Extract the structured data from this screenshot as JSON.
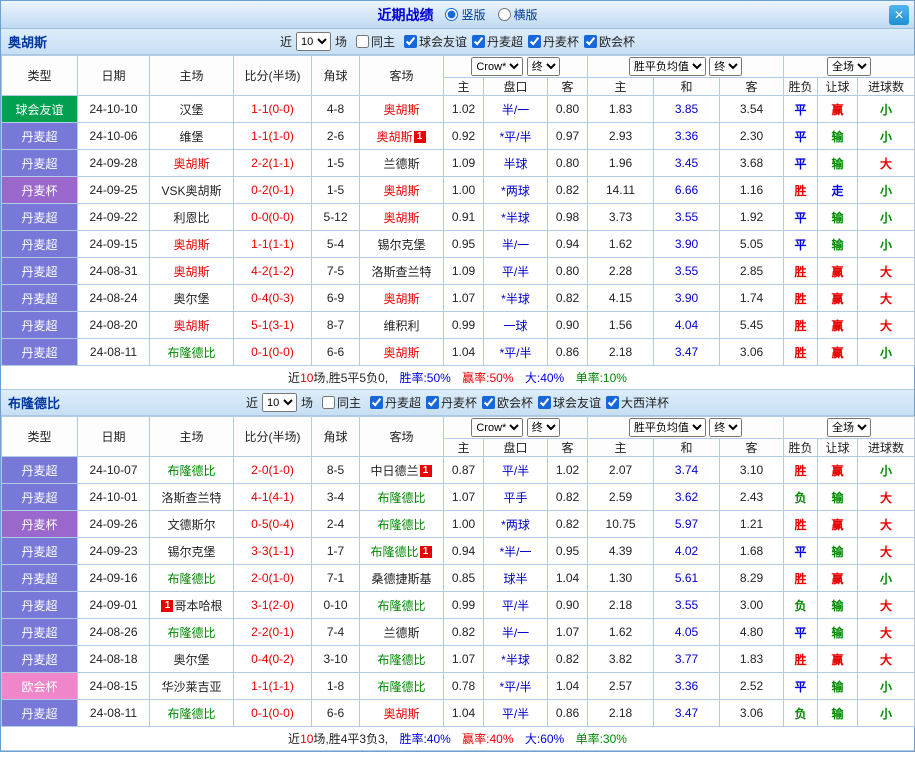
{
  "titlebar": {
    "title": "近期战绩",
    "vertical": "竖版",
    "horizontal": "横版",
    "close": "✕"
  },
  "palette": {
    "win_red": "#e80000",
    "lose_green": "#008800",
    "draw_blue": "#0000e6",
    "type_friendly": "#00a050",
    "type_super": "#7878d8",
    "type_cup": "#9a68cc",
    "type_conf": "#ef86ca"
  },
  "table_header": {
    "type": "类型",
    "date": "日期",
    "home": "主场",
    "score": "比分(半场)",
    "corner": "角球",
    "away": "客场",
    "odds_source": "Crow*",
    "final": "终",
    "avg_label": "胜平负均值",
    "scope": "全场",
    "h": "主",
    "handicap": "盘口",
    "a": "客",
    "draw": "和",
    "result": "胜负",
    "let": "让球",
    "goals": "进球数"
  },
  "sections": [
    {
      "team": "奥胡斯",
      "filter": {
        "near": "近",
        "count": "10",
        "games": "场",
        "same_home": "同主",
        "leagues": [
          "球会友谊",
          "丹麦超",
          "丹麦杯",
          "欧会杯"
        ]
      },
      "rows": [
        {
          "league": "球会友谊",
          "league_key": "friendly",
          "date": "24-10-10",
          "home": {
            "name": "汉堡"
          },
          "score": "1-1(0-0)",
          "corners": "4-8",
          "away": {
            "name": "奥胡斯",
            "color": "red"
          },
          "odds": [
            "1.02",
            "半/一",
            "0.80"
          ],
          "avg": [
            "1.83",
            "3.85",
            "3.54"
          ],
          "result": {
            "text": "平",
            "color": "blue"
          },
          "asian": {
            "text": "赢",
            "color": "red"
          },
          "goals": {
            "text": "小",
            "color": "green"
          }
        },
        {
          "league": "丹麦超",
          "league_key": "super",
          "date": "24-10-06",
          "home": {
            "name": "维堡"
          },
          "score": "1-1(1-0)",
          "corners": "2-6",
          "away": {
            "name": "奥胡斯",
            "color": "red",
            "badge": "after"
          },
          "odds": [
            "0.92",
            "*平/半",
            "0.97"
          ],
          "avg": [
            "2.93",
            "3.36",
            "2.30"
          ],
          "result": {
            "text": "平",
            "color": "blue"
          },
          "asian": {
            "text": "输",
            "color": "green"
          },
          "goals": {
            "text": "小",
            "color": "green"
          }
        },
        {
          "league": "丹麦超",
          "league_key": "super",
          "date": "24-09-28",
          "home": {
            "name": "奥胡斯",
            "color": "red"
          },
          "score": "2-2(1-1)",
          "corners": "1-5",
          "away": {
            "name": "兰德斯"
          },
          "odds": [
            "1.09",
            "半球",
            "0.80"
          ],
          "avg": [
            "1.96",
            "3.45",
            "3.68"
          ],
          "result": {
            "text": "平",
            "color": "blue"
          },
          "asian": {
            "text": "输",
            "color": "green"
          },
          "goals": {
            "text": "大",
            "color": "red"
          }
        },
        {
          "league": "丹麦杯",
          "league_key": "cup",
          "date": "24-09-25",
          "home": {
            "name": "VSK奥胡斯"
          },
          "score": "0-2(0-1)",
          "corners": "1-5",
          "away": {
            "name": "奥胡斯",
            "color": "red"
          },
          "odds": [
            "1.00",
            "*两球",
            "0.82"
          ],
          "avg": [
            "14.11",
            "6.66",
            "1.16"
          ],
          "result": {
            "text": "胜",
            "color": "red"
          },
          "asian": {
            "text": "走",
            "color": "blue"
          },
          "goals": {
            "text": "小",
            "color": "green"
          }
        },
        {
          "league": "丹麦超",
          "league_key": "super",
          "date": "24-09-22",
          "home": {
            "name": "利恩比"
          },
          "score": "0-0(0-0)",
          "corners": "5-12",
          "away": {
            "name": "奥胡斯",
            "color": "red"
          },
          "odds": [
            "0.91",
            "*半球",
            "0.98"
          ],
          "avg": [
            "3.73",
            "3.55",
            "1.92"
          ],
          "result": {
            "text": "平",
            "color": "blue"
          },
          "asian": {
            "text": "输",
            "color": "green"
          },
          "goals": {
            "text": "小",
            "color": "green"
          }
        },
        {
          "league": "丹麦超",
          "league_key": "super",
          "date": "24-09-15",
          "home": {
            "name": "奥胡斯",
            "color": "red"
          },
          "score": "1-1(1-1)",
          "corners": "5-4",
          "away": {
            "name": "锡尔克堡"
          },
          "odds": [
            "0.95",
            "半/一",
            "0.94"
          ],
          "avg": [
            "1.62",
            "3.90",
            "5.05"
          ],
          "result": {
            "text": "平",
            "color": "blue"
          },
          "asian": {
            "text": "输",
            "color": "green"
          },
          "goals": {
            "text": "小",
            "color": "green"
          }
        },
        {
          "league": "丹麦超",
          "league_key": "super",
          "date": "24-08-31",
          "home": {
            "name": "奥胡斯",
            "color": "red"
          },
          "score": "4-2(1-2)",
          "corners": "7-5",
          "away": {
            "name": "洛斯查兰特"
          },
          "odds": [
            "1.09",
            "平/半",
            "0.80"
          ],
          "avg": [
            "2.28",
            "3.55",
            "2.85"
          ],
          "result": {
            "text": "胜",
            "color": "red"
          },
          "asian": {
            "text": "赢",
            "color": "red"
          },
          "goals": {
            "text": "大",
            "color": "red"
          }
        },
        {
          "league": "丹麦超",
          "league_key": "super",
          "date": "24-08-24",
          "home": {
            "name": "奥尔堡"
          },
          "score": "0-4(0-3)",
          "corners": "6-9",
          "away": {
            "name": "奥胡斯",
            "color": "red"
          },
          "odds": [
            "1.07",
            "*半球",
            "0.82"
          ],
          "avg": [
            "4.15",
            "3.90",
            "1.74"
          ],
          "result": {
            "text": "胜",
            "color": "red"
          },
          "asian": {
            "text": "赢",
            "color": "red"
          },
          "goals": {
            "text": "大",
            "color": "red"
          }
        },
        {
          "league": "丹麦超",
          "league_key": "super",
          "date": "24-08-20",
          "home": {
            "name": "奥胡斯",
            "color": "red"
          },
          "score": "5-1(3-1)",
          "corners": "8-7",
          "away": {
            "name": "维积利"
          },
          "odds": [
            "0.99",
            "一球",
            "0.90"
          ],
          "avg": [
            "1.56",
            "4.04",
            "5.45"
          ],
          "result": {
            "text": "胜",
            "color": "red"
          },
          "asian": {
            "text": "赢",
            "color": "red"
          },
          "goals": {
            "text": "大",
            "color": "red"
          }
        },
        {
          "league": "丹麦超",
          "league_key": "super",
          "date": "24-08-11",
          "home": {
            "name": "布隆德比",
            "color": "green"
          },
          "score": "0-1(0-0)",
          "corners": "6-6",
          "away": {
            "name": "奥胡斯",
            "color": "red"
          },
          "odds": [
            "1.04",
            "*平/半",
            "0.86"
          ],
          "avg": [
            "2.18",
            "3.47",
            "3.06"
          ],
          "result": {
            "text": "胜",
            "color": "red"
          },
          "asian": {
            "text": "赢",
            "color": "red"
          },
          "goals": {
            "text": "小",
            "color": "green"
          }
        }
      ],
      "summary": {
        "near": "近",
        "count": "10",
        "mid": "场,胜5平5负0,",
        "win": "胜率:50%",
        "asian": "赢率:50%",
        "big": "大:40%",
        "odd": "单率:10%"
      }
    },
    {
      "team": "布隆德比",
      "filter": {
        "near": "近",
        "count": "10",
        "games": "场",
        "same_home": "同主",
        "leagues": [
          "丹麦超",
          "丹麦杯",
          "欧会杯",
          "球会友谊",
          "大西洋杯"
        ]
      },
      "rows": [
        {
          "league": "丹麦超",
          "league_key": "super",
          "date": "24-10-07",
          "home": {
            "name": "布隆德比",
            "color": "green"
          },
          "score": "2-0(1-0)",
          "corners": "8-5",
          "away": {
            "name": "中日德兰",
            "badge": "after"
          },
          "odds": [
            "0.87",
            "平/半",
            "1.02"
          ],
          "avg": [
            "2.07",
            "3.74",
            "3.10"
          ],
          "result": {
            "text": "胜",
            "color": "red"
          },
          "asian": {
            "text": "赢",
            "color": "red"
          },
          "goals": {
            "text": "小",
            "color": "green"
          }
        },
        {
          "league": "丹麦超",
          "league_key": "super",
          "date": "24-10-01",
          "home": {
            "name": "洛斯查兰特"
          },
          "score": "4-1(4-1)",
          "corners": "3-4",
          "away": {
            "name": "布隆德比",
            "color": "green"
          },
          "odds": [
            "1.07",
            "平手",
            "0.82"
          ],
          "avg": [
            "2.59",
            "3.62",
            "2.43"
          ],
          "result": {
            "text": "负",
            "color": "green"
          },
          "asian": {
            "text": "输",
            "color": "green"
          },
          "goals": {
            "text": "大",
            "color": "red"
          }
        },
        {
          "league": "丹麦杯",
          "league_key": "cup",
          "date": "24-09-26",
          "home": {
            "name": "文德斯尔"
          },
          "score": "0-5(0-4)",
          "corners": "2-4",
          "away": {
            "name": "布隆德比",
            "color": "green"
          },
          "odds": [
            "1.00",
            "*两球",
            "0.82"
          ],
          "avg": [
            "10.75",
            "5.97",
            "1.21"
          ],
          "result": {
            "text": "胜",
            "color": "red"
          },
          "asian": {
            "text": "赢",
            "color": "red"
          },
          "goals": {
            "text": "大",
            "color": "red"
          }
        },
        {
          "league": "丹麦超",
          "league_key": "super",
          "date": "24-09-23",
          "home": {
            "name": "锡尔克堡"
          },
          "score": "3-3(1-1)",
          "corners": "1-7",
          "away": {
            "name": "布隆德比",
            "color": "green",
            "badge": "after"
          },
          "odds": [
            "0.94",
            "*半/一",
            "0.95"
          ],
          "avg": [
            "4.39",
            "4.02",
            "1.68"
          ],
          "result": {
            "text": "平",
            "color": "blue"
          },
          "asian": {
            "text": "输",
            "color": "green"
          },
          "goals": {
            "text": "大",
            "color": "red"
          }
        },
        {
          "league": "丹麦超",
          "league_key": "super",
          "date": "24-09-16",
          "home": {
            "name": "布隆德比",
            "color": "green"
          },
          "score": "2-0(1-0)",
          "corners": "7-1",
          "away": {
            "name": "桑德捷斯基"
          },
          "odds": [
            "0.85",
            "球半",
            "1.04"
          ],
          "avg": [
            "1.30",
            "5.61",
            "8.29"
          ],
          "result": {
            "text": "胜",
            "color": "red"
          },
          "asian": {
            "text": "赢",
            "color": "red"
          },
          "goals": {
            "text": "小",
            "color": "green"
          }
        },
        {
          "league": "丹麦超",
          "league_key": "super",
          "date": "24-09-01",
          "home": {
            "name": "哥本哈根",
            "badge": "before"
          },
          "score": "3-1(2-0)",
          "corners": "0-10",
          "away": {
            "name": "布隆德比",
            "color": "green"
          },
          "odds": [
            "0.99",
            "平/半",
            "0.90"
          ],
          "avg": [
            "2.18",
            "3.55",
            "3.00"
          ],
          "result": {
            "text": "负",
            "color": "green"
          },
          "asian": {
            "text": "输",
            "color": "green"
          },
          "goals": {
            "text": "大",
            "color": "red"
          }
        },
        {
          "league": "丹麦超",
          "league_key": "super",
          "date": "24-08-26",
          "home": {
            "name": "布隆德比",
            "color": "green"
          },
          "score": "2-2(0-1)",
          "corners": "7-4",
          "away": {
            "name": "兰德斯"
          },
          "odds": [
            "0.82",
            "半/一",
            "1.07"
          ],
          "avg": [
            "1.62",
            "4.05",
            "4.80"
          ],
          "result": {
            "text": "平",
            "color": "blue"
          },
          "asian": {
            "text": "输",
            "color": "green"
          },
          "goals": {
            "text": "大",
            "color": "red"
          }
        },
        {
          "league": "丹麦超",
          "league_key": "super",
          "date": "24-08-18",
          "home": {
            "name": "奥尔堡"
          },
          "score": "0-4(0-2)",
          "corners": "3-10",
          "away": {
            "name": "布隆德比",
            "color": "green"
          },
          "odds": [
            "1.07",
            "*半球",
            "0.82"
          ],
          "avg": [
            "3.82",
            "3.77",
            "1.83"
          ],
          "result": {
            "text": "胜",
            "color": "red"
          },
          "asian": {
            "text": "赢",
            "color": "red"
          },
          "goals": {
            "text": "大",
            "color": "red"
          }
        },
        {
          "league": "欧会杯",
          "league_key": "conf",
          "date": "24-08-15",
          "home": {
            "name": "华沙莱吉亚"
          },
          "score": "1-1(1-1)",
          "corners": "1-8",
          "away": {
            "name": "布隆德比",
            "color": "green"
          },
          "odds": [
            "0.78",
            "*平/半",
            "1.04"
          ],
          "avg": [
            "2.57",
            "3.36",
            "2.52"
          ],
          "result": {
            "text": "平",
            "color": "blue"
          },
          "asian": {
            "text": "输",
            "color": "green"
          },
          "goals": {
            "text": "小",
            "color": "green"
          }
        },
        {
          "league": "丹麦超",
          "league_key": "super",
          "date": "24-08-11",
          "home": {
            "name": "布隆德比",
            "color": "green"
          },
          "score": "0-1(0-0)",
          "corners": "6-6",
          "away": {
            "name": "奥胡斯",
            "color": "red"
          },
          "odds": [
            "1.04",
            "平/半",
            "0.86"
          ],
          "avg": [
            "2.18",
            "3.47",
            "3.06"
          ],
          "result": {
            "text": "负",
            "color": "green"
          },
          "asian": {
            "text": "输",
            "color": "green"
          },
          "goals": {
            "text": "小",
            "color": "green"
          }
        }
      ],
      "summary": {
        "near": "近",
        "count": "10",
        "mid": "场,胜4平3负3,",
        "win": "胜率:40%",
        "asian": "赢率:40%",
        "big": "大:60%",
        "odd": "单率:30%"
      }
    }
  ]
}
